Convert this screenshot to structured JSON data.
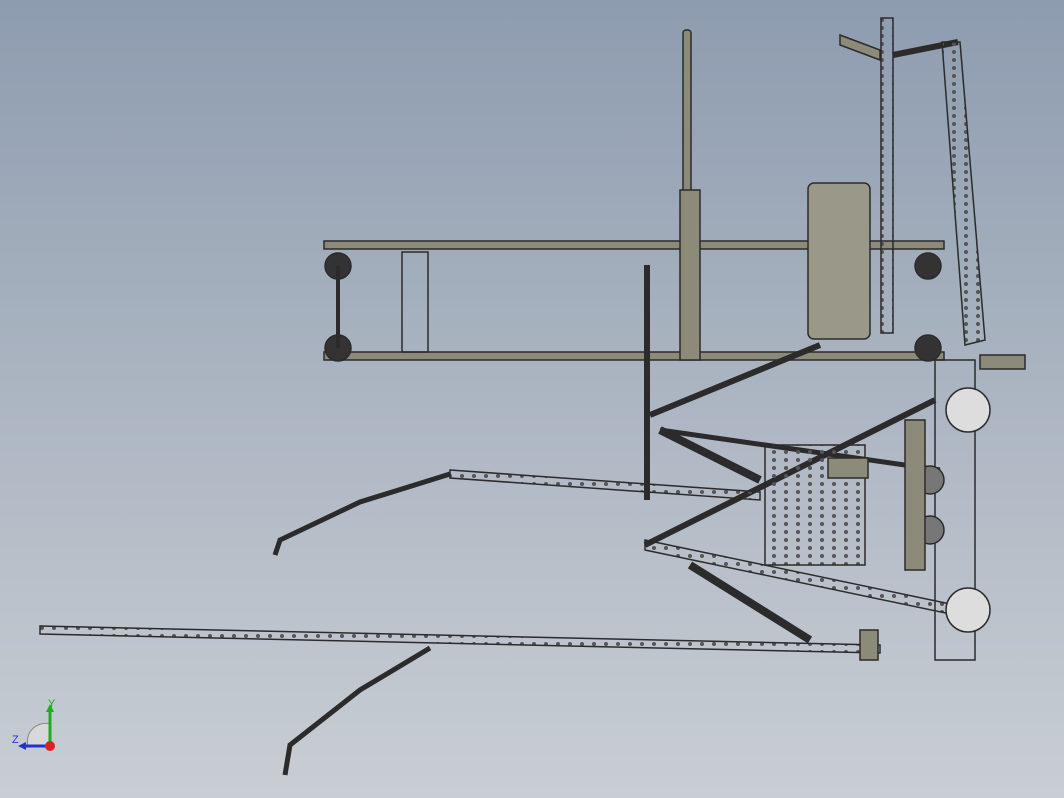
{
  "viewport": {
    "background_top": "#8e9cb0",
    "background_bottom": "#c9ced4",
    "model_line_color": "#2b2b2b",
    "model_fill_color": "#8c8a78"
  },
  "triad": {
    "y_label": "Y",
    "z_label": "Z",
    "y_color": "#22aa22",
    "z_color": "#2233cc",
    "x_color": "#dd2222"
  }
}
